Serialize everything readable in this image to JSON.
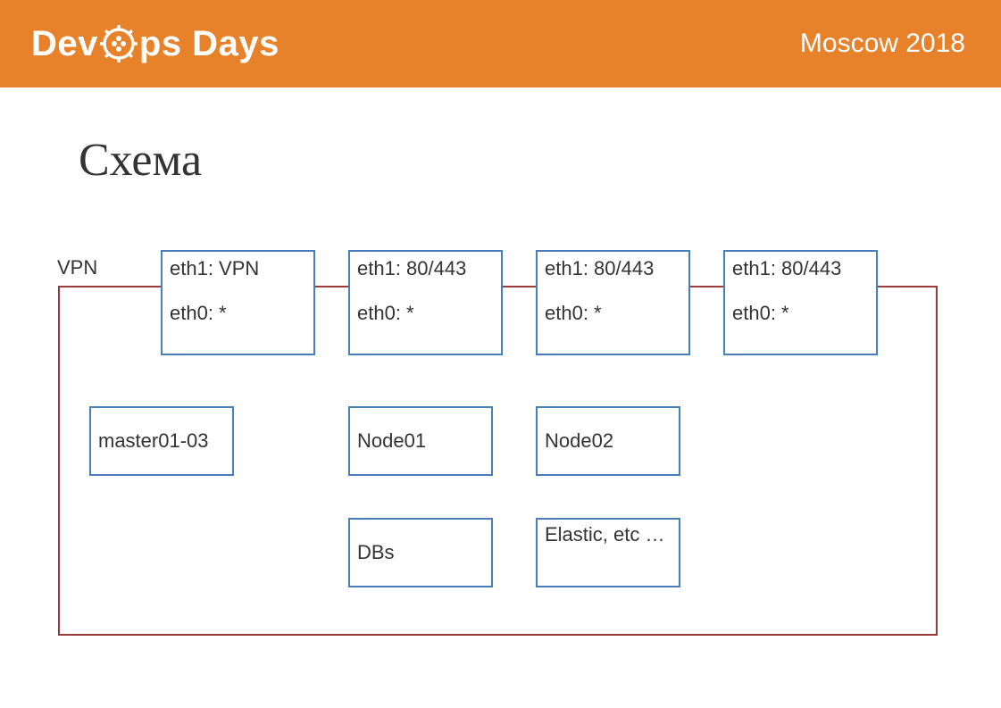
{
  "header": {
    "brand_part1": "Dev",
    "brand_part2": "ps Days",
    "event": "Moscow 2018"
  },
  "title": "Схема",
  "vpn_label": "VPN",
  "top_boxes": [
    {
      "eth1": "eth1: VPN",
      "eth0": "eth0: *"
    },
    {
      "eth1": "eth1: 80/443",
      "eth0": "eth0: *"
    },
    {
      "eth1": "eth1: 80/443",
      "eth0": "eth0: *"
    },
    {
      "eth1": "eth1: 80/443",
      "eth0": "eth0: *"
    }
  ],
  "mid_boxes": {
    "master": "master01-03",
    "node01": "Node01",
    "node02": "Node02"
  },
  "bottom_boxes": {
    "dbs": "DBs",
    "elastic": "Elastic, etc …"
  }
}
